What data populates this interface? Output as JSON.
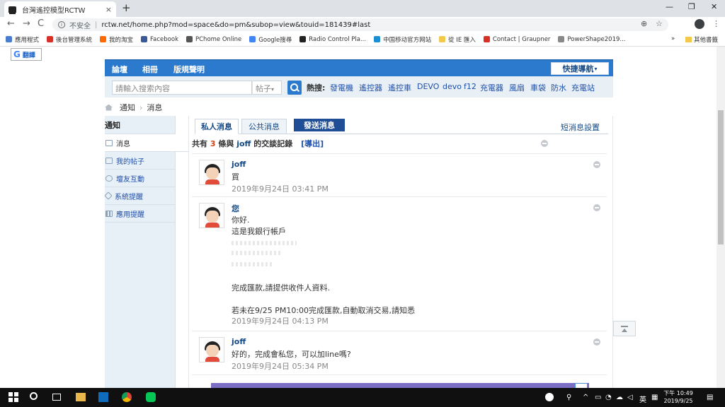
{
  "browser": {
    "tab_title": "台灣遙控模型RCTW",
    "tab_close": "×",
    "new_tab": "+",
    "win_min": "—",
    "win_max": "❐",
    "win_close": "✕",
    "back": "←",
    "forward": "→",
    "reload": "C",
    "security_label": "不安全",
    "url": "rctw.net/home.php?mod=space&do=pm&subop=view&touid=181439#last",
    "zoom_icon": "⊕",
    "star_icon": "☆",
    "menu_icon": "⋮",
    "bookmarks": [
      {
        "label": "應用程式",
        "color": "#4a7bd1"
      },
      {
        "label": "後台管理系統",
        "color": "#d93025"
      },
      {
        "label": "我的淘宝",
        "color": "#ff6a00"
      },
      {
        "label": "Facebook",
        "color": "#3b5998"
      },
      {
        "label": "PChome Online",
        "color": "#555555"
      },
      {
        "label": "Google搜尋",
        "color": "#4285f4"
      },
      {
        "label": "Radio Control Pla...",
        "color": "#222222"
      },
      {
        "label": "中国移动官方网站",
        "color": "#1b8fd3"
      },
      {
        "label": "從 IE 匯入",
        "color": "#f2c94c"
      },
      {
        "label": "Contact | Graupner",
        "color": "#d93025"
      },
      {
        "label": "PowerShape2019...",
        "color": "#888888"
      }
    ],
    "bookmarks_more": "»",
    "other_bookmarks": "其他書籤"
  },
  "translate_button": "翻譯",
  "translate_g": "G",
  "topnav": {
    "items": [
      "論壇",
      "相冊",
      "版規聲明"
    ],
    "quick_nav": "快捷導航"
  },
  "search": {
    "placeholder": "請輸入搜索內容",
    "type": "帖子",
    "hot_label": "熱搜:",
    "hot_terms": [
      "發電機",
      "遙控器",
      "遙控車",
      "DEVO",
      "devo",
      "f12",
      "充電器",
      "風扇",
      "車袋",
      "防水",
      "充電站"
    ]
  },
  "breadcrumb": [
    "通知",
    "消息"
  ],
  "breadcrumb_sep": "›",
  "sidebar": {
    "title": "通知",
    "items": [
      "消息",
      "我的帖子",
      "壇友互動",
      "系統提醒",
      "應用提醒"
    ]
  },
  "tabs": {
    "private": "私人消息",
    "public": "公共消息",
    "send": "發送消息",
    "settings": "短消息設置"
  },
  "summary": {
    "prefix": "共有",
    "count": "3",
    "mid": "條與",
    "user": "joff",
    "suffix": "的交談記錄",
    "export": "[導出]"
  },
  "messages": [
    {
      "author": "joff",
      "lines": [
        "買"
      ],
      "time": "2019年9月24日 03:41 PM"
    },
    {
      "author": "您",
      "lines": [
        "你好.",
        "這是我銀行帳戶",
        "完成匯款,請提供收件人資料.",
        "若未在9/25 PM10:00完成匯款,自動取消交易,請知悉"
      ],
      "time": "2019年9月24日 04:13 PM"
    },
    {
      "author": "joff",
      "lines": [
        "好的，完成會私您，可以加line嗎?"
      ],
      "time": "2019年9月24日 05:34 PM"
    }
  ],
  "taskbar": {
    "ime": "英",
    "time": "下午 10:49",
    "date": "2019/9/25"
  }
}
